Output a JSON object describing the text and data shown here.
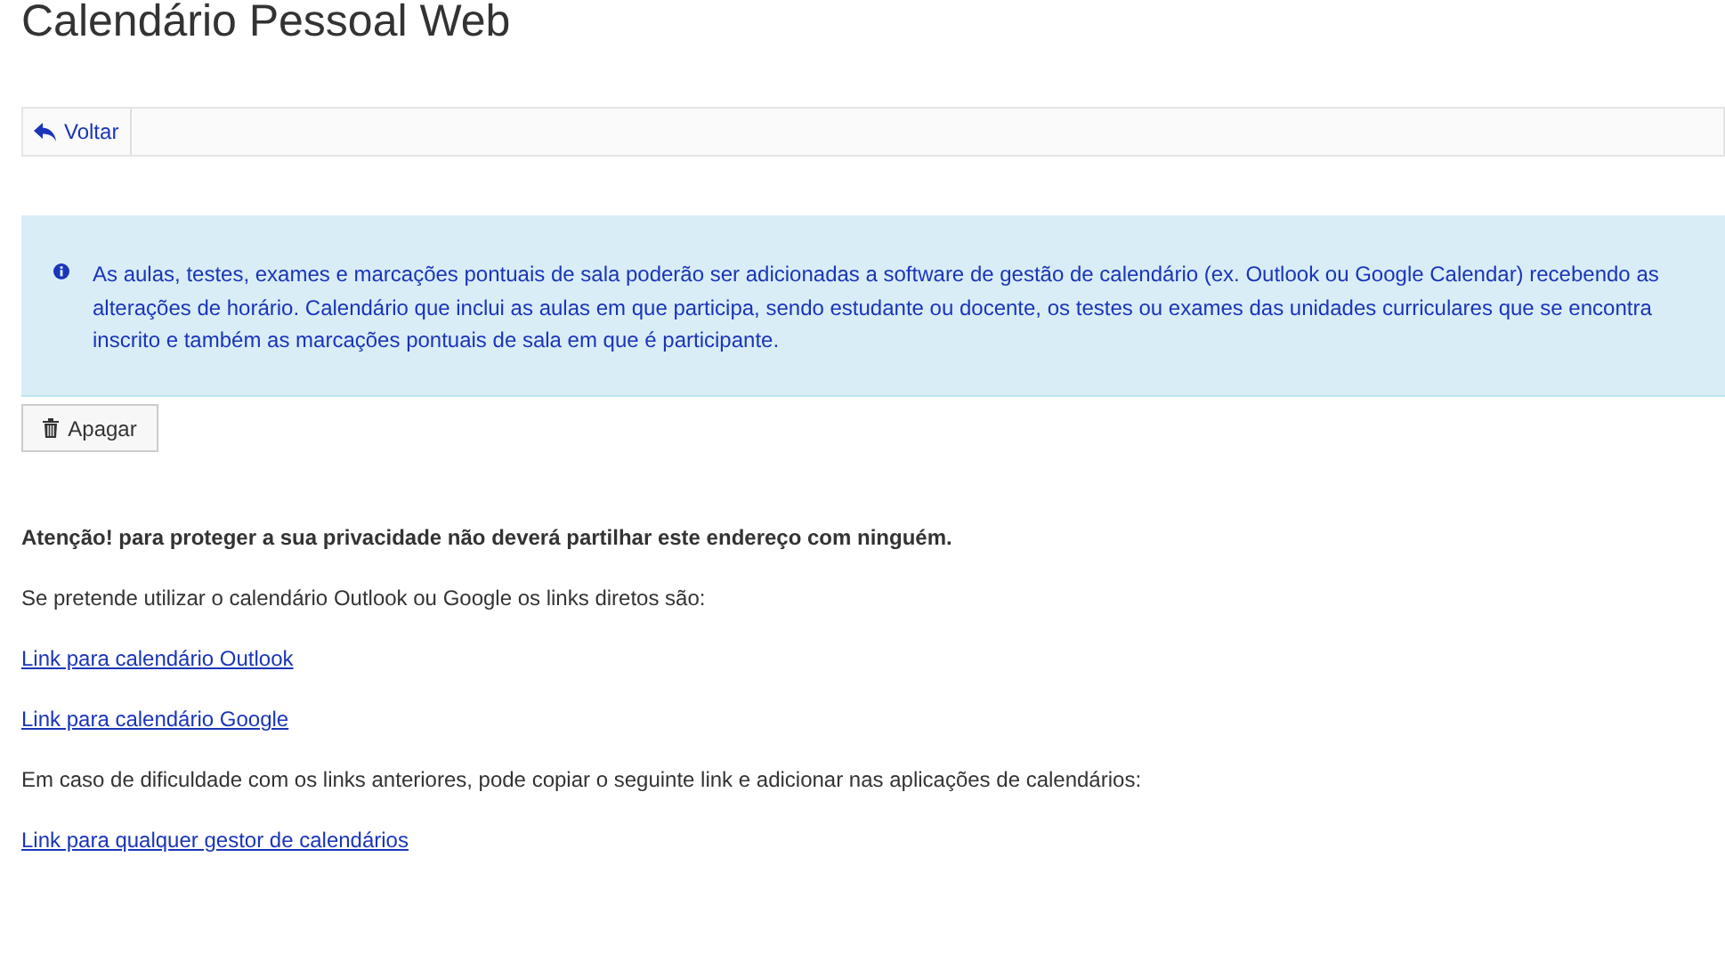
{
  "page_title": "Calendário Pessoal Web",
  "toolbar": {
    "back_button": "Voltar"
  },
  "info_alert": "As aulas, testes, exames e marcações pontuais de sala poderão ser adicionadas a software de gestão de calendário (ex. Outlook ou Google Calendar) recebendo as alterações de horário. Calendário que inclui as aulas em que participa, sendo estudante ou docente, os testes ou exames das unidades curriculares que se encontra inscrito e também as marcações pontuais de sala em que é participante.",
  "delete_button": "Apagar",
  "content": [
    {
      "kind": "warning",
      "text": "Atenção! para proteger a sua privacidade não deverá partilhar este endereço com ninguém."
    },
    {
      "kind": "text",
      "text": "Se pretende utilizar o calendário Outlook ou Google os links diretos são:"
    },
    {
      "kind": "link",
      "text": "Link para calendário Outlook"
    },
    {
      "kind": "link",
      "text": "Link para calendário Google"
    },
    {
      "kind": "text",
      "text": "Em caso de dificuldade com os links anteriores, pode copiar o seguinte link e adicionar nas aplicações de calendários:"
    },
    {
      "kind": "link",
      "text": "Link para qualquer gestor de calendários"
    }
  ]
}
